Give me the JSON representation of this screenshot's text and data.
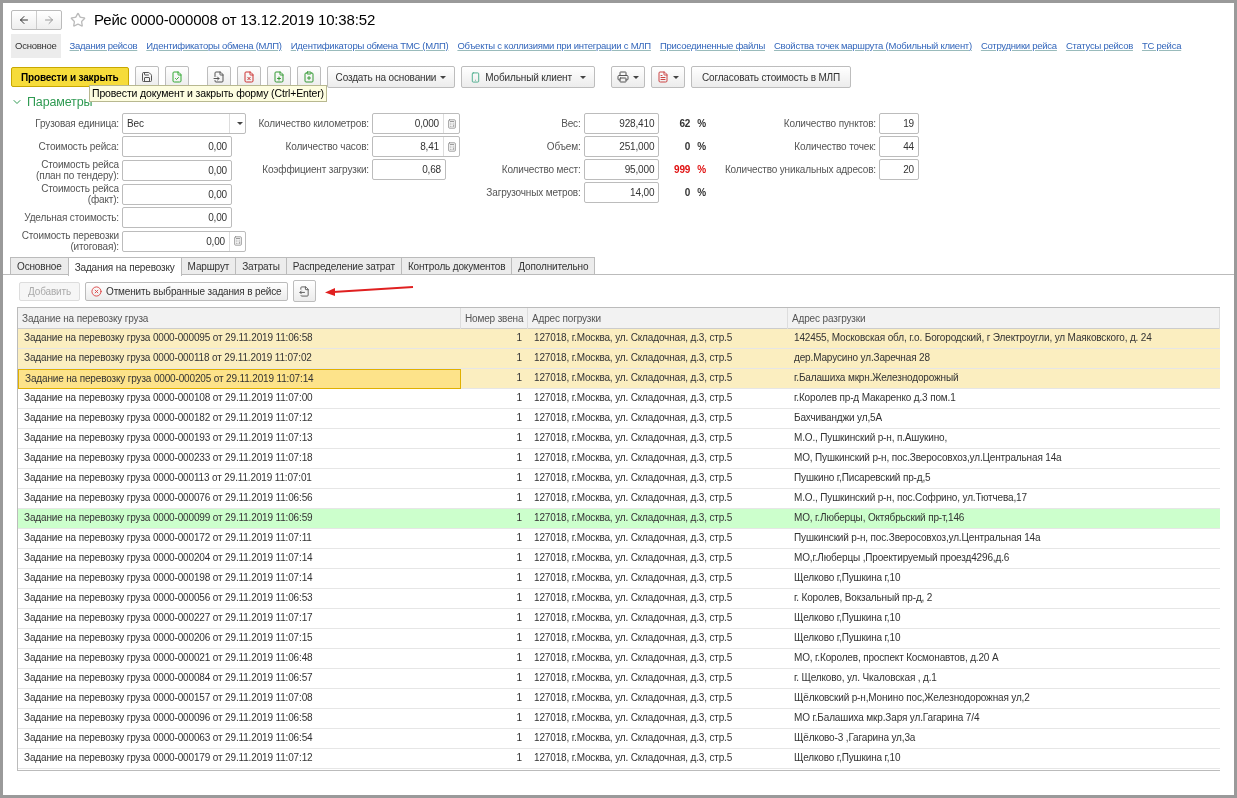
{
  "window": {
    "title": "Рейс 0000-000008 от 13.12.2019 10:38:52"
  },
  "nav_links": [
    {
      "label": "Основное",
      "selected": true
    },
    {
      "label": "Задания рейсов",
      "selected": false
    },
    {
      "label": "Идентификаторы обмена (МЛП)",
      "selected": false
    },
    {
      "label": "Идентификаторы обмена ТМС (МЛП)",
      "selected": false
    },
    {
      "label": "Объекты с коллизиями при интеграции с МЛП",
      "selected": false
    },
    {
      "label": "Присоединенные файлы",
      "selected": false
    },
    {
      "label": "Свойства точек маршрута (Мобильный клиент)",
      "selected": false
    },
    {
      "label": "Сотрудники рейса",
      "selected": false
    },
    {
      "label": "Статусы рейсов",
      "selected": false
    },
    {
      "label": "ТС рейса",
      "selected": false
    }
  ],
  "toolbar": {
    "primary": "Провести и закрыть",
    "create_based": "Создать на основании",
    "mobile": "Мобильный клиент",
    "approve": "Согласовать стоимость в МЛП"
  },
  "tooltip": "Провести документ и закрыть форму (Ctrl+Enter)",
  "section_title": "Параметры",
  "col1": [
    {
      "label": "Грузовая единица:",
      "value": "Вес",
      "kind": "select"
    },
    {
      "label": "Стоимость рейса:",
      "value": "0,00",
      "kind": "number"
    },
    {
      "label": "Стоимость рейса (план по тендеру):",
      "value": "0,00",
      "kind": "number"
    },
    {
      "label": "Стоимость рейса (факт):",
      "value": "0,00",
      "kind": "number"
    },
    {
      "label": "Удельная стоимость:",
      "value": "0,00",
      "kind": "number"
    },
    {
      "label": "Стоимость перевозки (итоговая):",
      "value": "0,00",
      "kind": "calc"
    }
  ],
  "col2": [
    {
      "label": "Количество километров:",
      "value": "0,000",
      "kind": "calc"
    },
    {
      "label": "Количество часов:",
      "value": "8,41",
      "kind": "calc"
    },
    {
      "label": "Коэффициент загрузки:",
      "value": "0,68",
      "kind": "number"
    }
  ],
  "col3": [
    {
      "label": "Вес:",
      "value": "928,410",
      "percent": "62",
      "unit": "%",
      "over": false
    },
    {
      "label": "Объем:",
      "value": "251,000",
      "percent": "0",
      "unit": "%",
      "over": false
    },
    {
      "label": "Количество мест:",
      "value": "95,000",
      "percent": "999",
      "unit": "%",
      "over": true
    },
    {
      "label": "Загрузочных метров:",
      "value": "14,00",
      "percent": "0",
      "unit": "%",
      "over": false
    }
  ],
  "col4": [
    {
      "label": "Количество пунктов:",
      "value": "19"
    },
    {
      "label": "Количество точек:",
      "value": "44"
    },
    {
      "label": "Количество уникальных адресов:",
      "value": "20"
    }
  ],
  "tabs": [
    {
      "label": "Основное",
      "selected": false
    },
    {
      "label": "Задания на перевозку",
      "selected": true
    },
    {
      "label": "Маршрут",
      "selected": false
    },
    {
      "label": "Затраты",
      "selected": false
    },
    {
      "label": "Распределение затрат",
      "selected": false
    },
    {
      "label": "Контроль документов",
      "selected": false
    },
    {
      "label": "Дополнительно",
      "selected": false
    }
  ],
  "tab_toolbar": {
    "add": {
      "label": "Добавить",
      "disabled": true
    },
    "cancel": "Отменить выбранные задания в рейсе"
  },
  "table": {
    "columns": [
      "Задание на перевозку груза",
      "Номер звена",
      "Адрес погрузки",
      "Адрес разгрузки"
    ],
    "rows": [
      {
        "cells": [
          "Задание на перевозку груза 0000-000095 от 29.11.2019 11:06:58",
          "1",
          "127018, г.Москва, ул. Складочная, д.3, стр.5",
          "142455, Московская обл, г.о. Богородский, г Электроугли, ул Маяковского, д. 24"
        ],
        "selected": true,
        "current": false,
        "highlighted": false
      },
      {
        "cells": [
          "Задание на перевозку груза 0000-000118 от 29.11.2019 11:07:02",
          "1",
          "127018, г.Москва, ул. Складочная, д.3, стр.5",
          "дер.Марусино ул.Заречная 28"
        ],
        "selected": true,
        "current": false,
        "highlighted": false
      },
      {
        "cells": [
          "Задание на перевозку груза 0000-000205 от 29.11.2019 11:07:14",
          "1",
          "127018, г.Москва, ул. Складочная, д.3, стр.5",
          "г.Балашиха мкрн.Железнодорожный"
        ],
        "selected": true,
        "current": true,
        "highlighted": false
      },
      {
        "cells": [
          "Задание на перевозку груза 0000-000108 от 29.11.2019 11:07:00",
          "1",
          "127018, г.Москва, ул. Складочная, д.3, стр.5",
          "г.Королев пр-д Макаренко д.3 пом.1"
        ],
        "selected": false,
        "current": false,
        "highlighted": false
      },
      {
        "cells": [
          "Задание на перевозку груза 0000-000182 от 29.11.2019 11:07:12",
          "1",
          "127018, г.Москва, ул. Складочная, д.3, стр.5",
          "Бахчиванджи  ул,5А"
        ],
        "selected": false,
        "current": false,
        "highlighted": false
      },
      {
        "cells": [
          "Задание на перевозку груза 0000-000193 от 29.11.2019 11:07:13",
          "1",
          "127018, г.Москва, ул. Складочная, д.3, стр.5",
          "М.О., Пушкинский р-н, п.Ашукино,"
        ],
        "selected": false,
        "current": false,
        "highlighted": false
      },
      {
        "cells": [
          "Задание на перевозку груза 0000-000233 от 29.11.2019 11:07:18",
          "1",
          "127018, г.Москва, ул. Складочная, д.3, стр.5",
          "МО, Пушкинский р-н, пос.Зверосовхоз,ул.Центральная 14а"
        ],
        "selected": false,
        "current": false,
        "highlighted": false
      },
      {
        "cells": [
          "Задание на перевозку груза 0000-000113 от 29.11.2019 11:07:01",
          "1",
          "127018, г.Москва, ул. Складочная, д.3, стр.5",
          "Пушкино г,Писаревский пр-д,5"
        ],
        "selected": false,
        "current": false,
        "highlighted": false
      },
      {
        "cells": [
          "Задание на перевозку груза 0000-000076 от 29.11.2019 11:06:56",
          "1",
          "127018, г.Москва, ул. Складочная, д.3, стр.5",
          "М.О., Пушкинский р-н, пос.Софрино, ул.Тютчева,17"
        ],
        "selected": false,
        "current": false,
        "highlighted": false
      },
      {
        "cells": [
          "Задание на перевозку груза 0000-000099 от 29.11.2019 11:06:59",
          "1",
          "127018, г.Москва, ул. Складочная, д.3, стр.5",
          "МО, г.Люберцы, Октябрьский пр-т,146"
        ],
        "selected": false,
        "current": false,
        "highlighted": true
      },
      {
        "cells": [
          "Задание на перевозку груза 0000-000172 от 29.11.2019 11:07:11",
          "1",
          "127018, г.Москва, ул. Складочная, д.3, стр.5",
          "Пушкинский р-н, пос.Зверосовхоз,ул.Центральная 14а"
        ],
        "selected": false,
        "current": false,
        "highlighted": false
      },
      {
        "cells": [
          "Задание на перевозку груза 0000-000204 от 29.11.2019 11:07:14",
          "1",
          "127018, г.Москва, ул. Складочная, д.3, стр.5",
          "МО,г.Люберцы ,Проектируемый проезд4296,д.6"
        ],
        "selected": false,
        "current": false,
        "highlighted": false
      },
      {
        "cells": [
          "Задание на перевозку груза 0000-000198 от 29.11.2019 11:07:14",
          "1",
          "127018, г.Москва, ул. Складочная, д.3, стр.5",
          "Щелково г,Пушкина г,10"
        ],
        "selected": false,
        "current": false,
        "highlighted": false
      },
      {
        "cells": [
          "Задание на перевозку груза 0000-000056 от 29.11.2019 11:06:53",
          "1",
          "127018, г.Москва, ул. Складочная, д.3, стр.5",
          "г. Королев, Вокзальный пр-д, 2"
        ],
        "selected": false,
        "current": false,
        "highlighted": false
      },
      {
        "cells": [
          "Задание на перевозку груза 0000-000227 от 29.11.2019 11:07:17",
          "1",
          "127018, г.Москва, ул. Складочная, д.3, стр.5",
          "Щелково г,Пушкина г,10"
        ],
        "selected": false,
        "current": false,
        "highlighted": false
      },
      {
        "cells": [
          "Задание на перевозку груза 0000-000206 от 29.11.2019 11:07:15",
          "1",
          "127018, г.Москва, ул. Складочная, д.3, стр.5",
          "Щелково г,Пушкина г,10"
        ],
        "selected": false,
        "current": false,
        "highlighted": false
      },
      {
        "cells": [
          "Задание на перевозку груза 0000-000021 от 29.11.2019 11:06:48",
          "1",
          "127018, г.Москва, ул. Складочная, д.3, стр.5",
          "МО, г.Королев, проспект Космонавтов, д.20 А"
        ],
        "selected": false,
        "current": false,
        "highlighted": false
      },
      {
        "cells": [
          "Задание на перевозку груза 0000-000084 от 29.11.2019 11:06:57",
          "1",
          "127018, г.Москва, ул. Складочная, д.3, стр.5",
          "г. Щелково, ул. Чкаловская , д.1"
        ],
        "selected": false,
        "current": false,
        "highlighted": false
      },
      {
        "cells": [
          "Задание на перевозку груза 0000-000157 от 29.11.2019 11:07:08",
          "1",
          "127018, г.Москва, ул. Складочная, д.3, стр.5",
          "Щёлковский р-н,Монино пос,Железнодорожная ул,2"
        ],
        "selected": false,
        "current": false,
        "highlighted": false
      },
      {
        "cells": [
          "Задание на перевозку груза 0000-000096 от 29.11.2019 11:06:58",
          "1",
          "127018, г.Москва, ул. Складочная, д.3, стр.5",
          "МО г.Балашиха мкр.Заря ул.Гагарина 7/4"
        ],
        "selected": false,
        "current": false,
        "highlighted": false
      },
      {
        "cells": [
          "Задание на перевозку груза 0000-000063 от 29.11.2019 11:06:54",
          "1",
          "127018, г.Москва, ул. Складочная, д.3, стр.5",
          "Щёлково-3 ,Гагарина ул,3а"
        ],
        "selected": false,
        "current": false,
        "highlighted": false
      },
      {
        "cells": [
          "Задание на перевозку груза 0000-000179 от 29.11.2019 11:07:12",
          "1",
          "127018, г.Москва, ул. Складочная, д.3, стр.5",
          "Щелково г,Пушкина г,10"
        ],
        "selected": false,
        "current": false,
        "highlighted": false
      }
    ]
  }
}
